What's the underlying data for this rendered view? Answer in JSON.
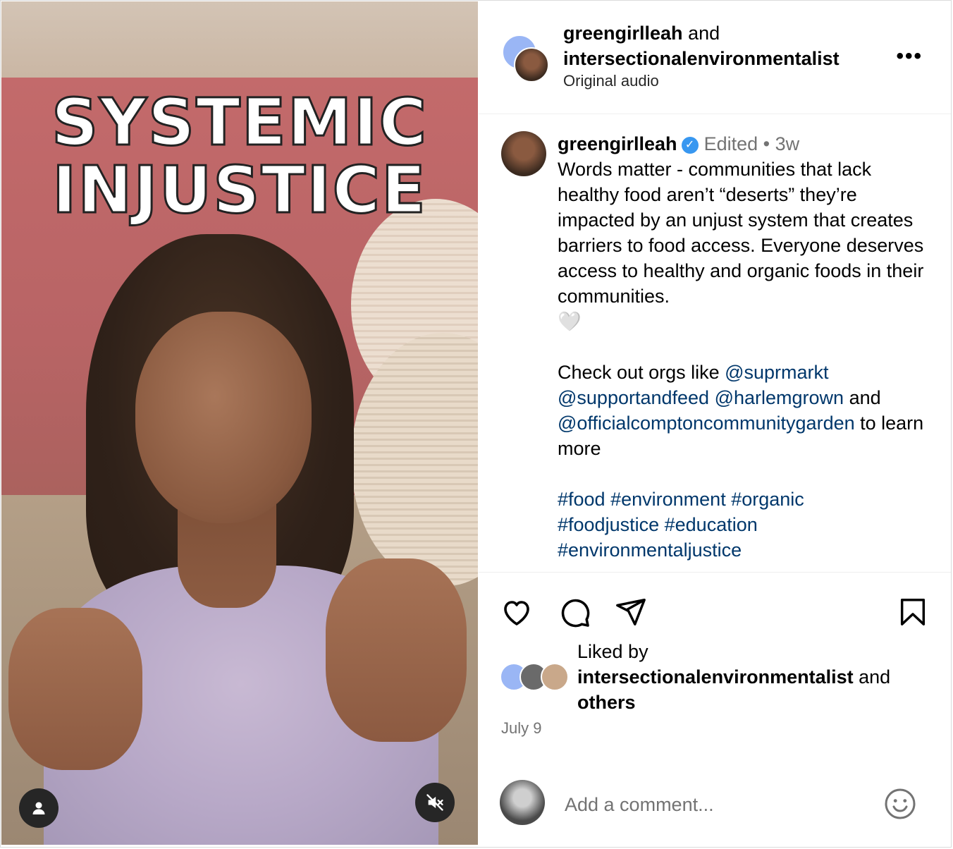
{
  "media": {
    "overlay_line1": "SYSTEMIC",
    "overlay_line2": "INJUSTICE",
    "user_icon": "user-icon",
    "mute_icon": "speaker-muted-icon"
  },
  "header": {
    "author1": "greengirlleah",
    "joiner": "and",
    "author2": "intersectionalenvironmentalist",
    "audio": "Original audio",
    "more_icon": "more-horizontal-icon",
    "more_label": "•••"
  },
  "caption": {
    "username": "greengirlleah",
    "verified_glyph": "✓",
    "edited": "Edited",
    "dot": "•",
    "age": "3w",
    "body": "Words matter - communities that lack healthy food aren’t “deserts” they’re impacted by an unjust system that creates barriers to food access. Everyone deserves access to healthy and organic foods in their communities.",
    "heart_emoji": "🤍",
    "check_out": "Check out orgs like ",
    "mention1": "@suprmarkt",
    "mention2": "@supportandfeed",
    "mention3": "@harlemgrown",
    "and": " and ",
    "mention4": "@officialcomptoncommunitygarden",
    "learn_more": " to learn more",
    "tag1": "#food",
    "tag2": "#environment",
    "tag3": "#organic",
    "tag4": "#foodjustice",
    "tag5": "#education",
    "tag6": "#environmentaljustice"
  },
  "actions": {
    "like_icon": "heart-icon",
    "comment_icon": "comment-icon",
    "share_icon": "paper-plane-icon",
    "save_icon": "bookmark-icon",
    "liked_by": "Liked by",
    "liked_user": "intersectionalenvironmentalist",
    "liked_and": " and",
    "others": "others",
    "date": "July 9"
  },
  "comment": {
    "placeholder": "Add a comment...",
    "emoji_icon": "smiley-icon"
  },
  "colors": {
    "link": "#00376b",
    "muted": "#737373",
    "verified": "#3897f0"
  }
}
